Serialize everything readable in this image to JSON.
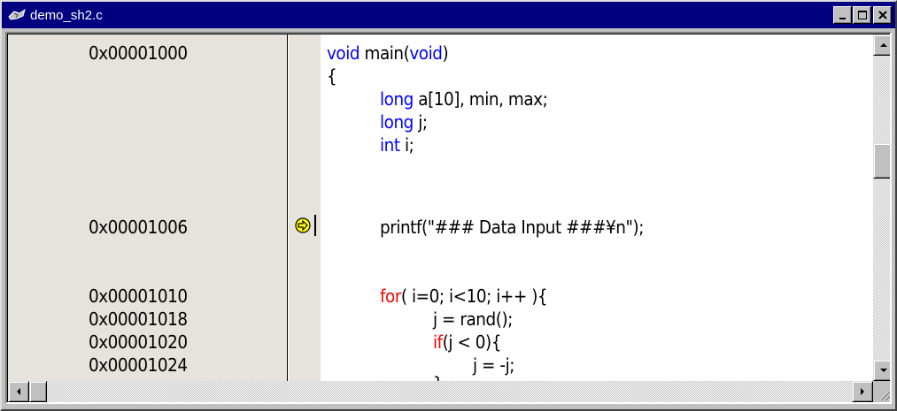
{
  "window": {
    "title": "demo_sh2.c",
    "title_icon": "file-icon",
    "titlebar_color": "#000080"
  },
  "addresses": [
    "0x00001000",
    "0x00001006",
    "0x00001010",
    "0x00001018",
    "0x00001020",
    "0x00001024"
  ],
  "source": {
    "l1_kw": "void",
    "l1_a": " main(",
    "l1_kw2": "void",
    "l1_b": ")",
    "l2": "{",
    "l3_kw": "long",
    "l3_rest": " a[10], min, max;",
    "l4_kw": "long",
    "l4_rest": " j;",
    "l5_kw": "int",
    "l5_rest": " i;",
    "l6": "printf(\"### Data Input ###¥n\");",
    "l7_kw": "for",
    "l7_rest": "( i=0; i<10; i++ ){",
    "l8": "j = rand();",
    "l9_kw": "if",
    "l9_rest": "(j < 0){",
    "l10": "j = -j;",
    "l11": "}"
  },
  "colors": {
    "keyword_type": "#0000ff",
    "keyword_control": "#ff0000",
    "gutter_bg": "#e6e2dc",
    "pc_arrow": "#ffff00"
  },
  "icons": {
    "pc_marker": "program-counter-arrow-icon",
    "minimize": "minimize-icon",
    "maximize": "maximize-icon",
    "close": "close-icon"
  }
}
